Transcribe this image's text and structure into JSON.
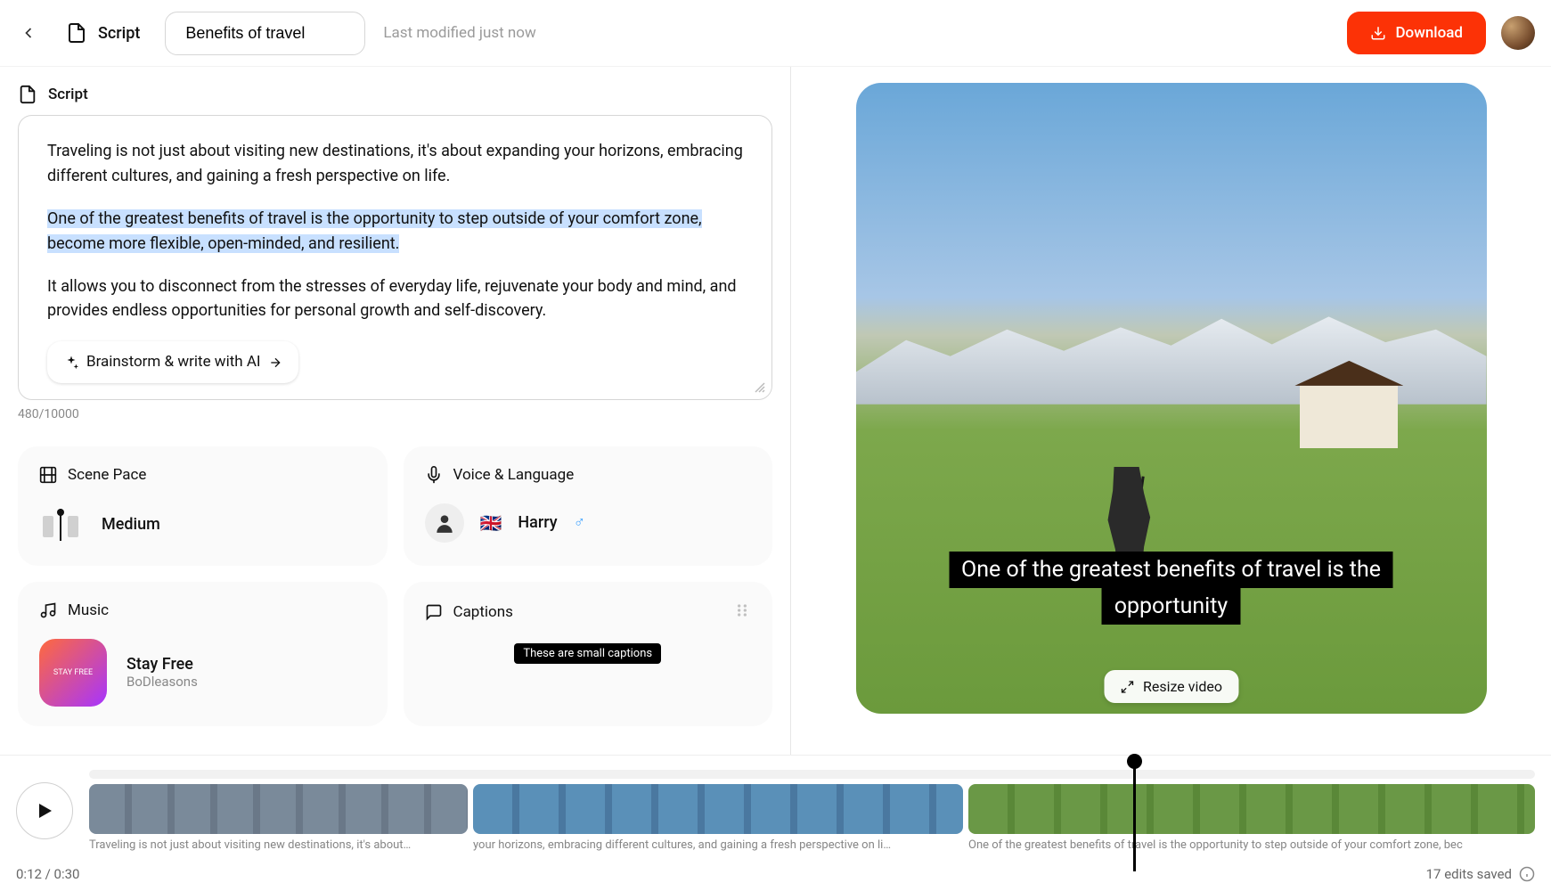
{
  "header": {
    "script_label": "Script",
    "title_value": "Benefits of travel",
    "modified": "Last modified just now",
    "download": "Download"
  },
  "script": {
    "heading": "Script",
    "p1": "Traveling is not just about visiting new destinations, it's about expanding your horizons, embracing different cultures, and gaining a fresh perspective on life.",
    "p2": "One of the greatest benefits of travel is the opportunity to step outside of your comfort zone, become more flexible, open-minded, and resilient.",
    "p3": "It allows you to disconnect from the stresses of everyday life, rejuvenate your body and mind, and provides endless opportunities for personal growth and self-discovery.",
    "ai_button": "Brainstorm & write with AI",
    "counter": "480/10000"
  },
  "scene_pace": {
    "title": "Scene Pace",
    "value": "Medium"
  },
  "voice": {
    "title": "Voice & Language",
    "flag": "🇬🇧",
    "name": "Harry",
    "gender": "♂"
  },
  "music": {
    "title": "Music",
    "track": "Stay Free",
    "artist": "BoDleasons",
    "cover_text": "STAY FREE"
  },
  "captions": {
    "title": "Captions",
    "sample": "These are small captions"
  },
  "preview": {
    "caption_line1": "One of the greatest benefits of travel is the",
    "caption_line2": "opportunity",
    "resize": "Resize video"
  },
  "timeline": {
    "clip1_text": "Traveling is not just about visiting new destinations, it's about…",
    "clip2_text": "your horizons, embracing different cultures, and gaining a fresh perspective on li…",
    "clip3_text": "One of the greatest benefits of travel is the opportunity to step outside of your comfort zone, bec",
    "time": "0:12 / 0:30",
    "edits": "17 edits saved"
  },
  "colors": {
    "accent": "#fc3206",
    "highlight": "#c8e0ff"
  }
}
